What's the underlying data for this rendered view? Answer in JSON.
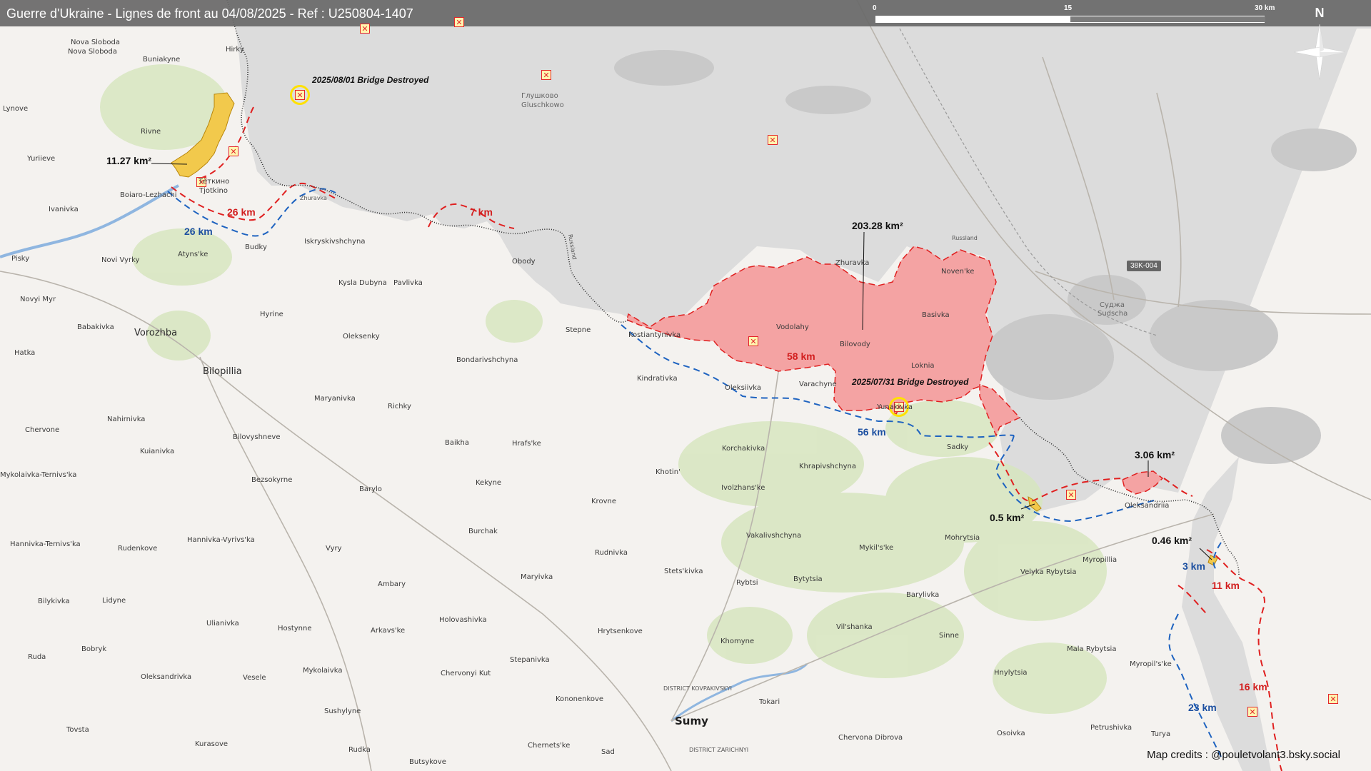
{
  "header": {
    "title": "Guerre d'Ukraine - Lignes de front au 04/08/2025 - Ref : U250804-1407",
    "scale": [
      "0",
      "15",
      "30 km"
    ],
    "north": "N"
  },
  "credits": "Map credits : @pouletvolant3.bsky.social",
  "road_badge": "38K-004",
  "colors": {
    "occupied_fill": "#f4a3a3",
    "claimed_line": "#e02020",
    "previous_line": "#1e63c0",
    "gain_fill": "#f2c94c",
    "border": "#222222",
    "event_ring": "#ffe100",
    "strike_marker": "#e3262b"
  },
  "distances": {
    "d26red": "26 km",
    "d26blue": "26 km",
    "d7": "7 km",
    "d58": "58 km",
    "d56": "56 km",
    "d3": "3 km",
    "d11": "11 km",
    "d16": "16 km",
    "d23": "23 km"
  },
  "areas": {
    "a1": "11.27 km²",
    "a2": "203.28 km²",
    "a3": "3.06 km²",
    "a4": "0.5 km²",
    "a5": "0.46 km²"
  },
  "events": {
    "e1": "2025/08/01 Bridge Destroyed",
    "e2": "2025/07/31 Bridge Destroyed"
  },
  "places": {
    "nova_sloboda": "Nova Sloboda",
    "buniakyne": "Buniakyne",
    "hirky": "Hirky",
    "lynove": "Lynove",
    "rivne": "Rivne",
    "yuriieve": "Yuriieve",
    "tiotkino": "Тёткино",
    "tjotkino": "Tjotkino",
    "boiaro": "Boiaro-Lezhachi",
    "ivanivka": "Ivanivka",
    "zhuravka_n": "Zhuravka",
    "pisky": "Pisky",
    "novi_vyrky": "Novi Vyrky",
    "atyns_ke": "Atyns'ke",
    "budky": "Budky",
    "iskryskivshchyna": "Iskryskivshchyna",
    "obody": "Obody",
    "glushkovo": "Глушково",
    "gluschkowo": "Gluschkowo",
    "kysla_dubyna": "Kysla Dubyna",
    "pavlivka": "Pavlivka",
    "novyi_myr": "Novyi Myr",
    "hyrine": "Hyrine",
    "babakivka": "Babakivka",
    "vorozhba": "Vorozhba",
    "oleksenky": "Oleksenky",
    "stepne": "Stepne",
    "hatka": "Hatka",
    "bilopillia": "Bilopillia",
    "bondarivshchyna": "Bondarivshchyna",
    "maryanivka": "Maryanivka",
    "richky": "Richky",
    "kindrativka": "Kindrativka",
    "kostiantynivka": "Kostiantynivka",
    "oleksiivka": "Oleksiivka",
    "varachyne": "Varachyne",
    "zhuravka": "Zhuravka",
    "vodolahy": "Vodolahy",
    "bilovody": "Bilovody",
    "loknia": "Loknia",
    "novenke": "Noven'ke",
    "basivka": "Basivka",
    "yunakivka": "Yunakivka",
    "russland1": "Russland",
    "russland2": "Russland",
    "sudzha": "Суджа",
    "sudscha": "Sudscha",
    "sadky": "Sadky",
    "chervone": "Chervone",
    "nahirnivka": "Nahirnivka",
    "bilovyshneve": "Bilovyshneve",
    "baikha": "Baikha",
    "hrafske": "Hrafs'ke",
    "korchakivka": "Korchakivka",
    "khrapivshchyna": "Khrapivshchyna",
    "kuianivka": "Kuianivka",
    "bezsokyrne": "Bezsokyrne",
    "mykolaivka_ternivska": "Mykolaivka-Ternivs'ka",
    "barylo": "Barylo",
    "kekyne": "Kekyne",
    "khotin": "Khotin'",
    "ivolzhanske": "Ivolzhans'ke",
    "krovne": "Krovne",
    "oleksandriia": "Oleksandriia",
    "hannivka_ternivska": "Hannivka-Ternivs'ka",
    "rudenkove": "Rudenkove",
    "hannivka_vyrivska": "Hannivka-Vyrivs'ka",
    "burchak": "Burchak",
    "vakalivshchyna": "Vakalivshchyna",
    "mykilske": "Mykil's'ke",
    "mohrytsia": "Mohrytsia",
    "vyry": "Vyry",
    "rudnivka": "Rudnivka",
    "myropillia": "Myropillia",
    "ambary": "Ambary",
    "stetskivka": "Stets'kivka",
    "rybtsi": "Rybtsi",
    "bytytsia": "Bytytsia",
    "velyka_rybytsia": "Velyka Rybytsia",
    "bilykivka": "Bilykivka",
    "lidyne": "Lidyne",
    "maryivka": "Maryivka",
    "barylivka": "Barylivka",
    "ulianivka": "Ulianivka",
    "hostynne": "Hostynne",
    "arkavske": "Arkavs'ke",
    "holovashivka": "Holovashivka",
    "hrytsenkove": "Hrytsenkove",
    "vilshanka": "Vil'shanka",
    "bobryk": "Bobryk",
    "khomyne": "Khomyne",
    "sinne": "Sinne",
    "mala_rybytsia": "Mala Rybytsia",
    "ruda": "Ruda",
    "stepanivka": "Stepanivka",
    "myropilske": "Myropil's'ke",
    "oleksandrivka": "Oleksandrivka",
    "vesele": "Vesele",
    "mykolaivka": "Mykolaivka",
    "chervonyi_kut": "Chervonyi Kut",
    "district_kovpak": "DISTRICT KOVPAKIVSKYI",
    "hnylytsia": "Hnylytsia",
    "kononenkove": "Kononenkove",
    "tokari": "Tokari",
    "sushylyne": "Sushylyne",
    "sumy": "Sumy",
    "tovsta": "Tovsta",
    "petrushivka": "Petrushivka",
    "turya": "Turya",
    "osoivka": "Osoivka",
    "kurasove": "Kurasove",
    "chervona_dibrova": "Chervona Dibrova",
    "district_zarich": "DISTRICT ZARICHNYI",
    "sad": "Sad",
    "chernetske": "Chernets'ke",
    "rudka": "Rudka",
    "butsykove": "Butsykove"
  }
}
